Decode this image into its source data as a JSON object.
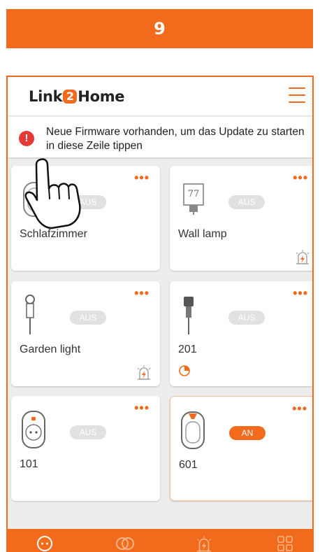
{
  "step": "9",
  "header": {
    "logo_left": "Link",
    "logo_mid": "2",
    "logo_right": "Home"
  },
  "notice": {
    "text": "Neue Firmware vorhanden, um das Update zu starten in diese Zeile tippen"
  },
  "devices": [
    {
      "name": "Schlafzimmer",
      "state": "AUS"
    },
    {
      "name": "Wall lamp",
      "state": "AUS",
      "lamp_label": "77"
    },
    {
      "name": "Garden light",
      "state": "AUS"
    },
    {
      "name": "201",
      "state": "AUS"
    },
    {
      "name": "101",
      "state": "AUS"
    },
    {
      "name": "601",
      "state": "AN"
    }
  ],
  "colors": {
    "accent": "#f26a1b",
    "alert": "#e53935",
    "pill_off": "#e1e1e1"
  },
  "icons": [
    "menu-icon",
    "alert-icon",
    "more-icon",
    "lightning-icon",
    "timer-icon",
    "devices-tab-icon",
    "scenes-tab-icon",
    "automation-tab-icon",
    "more-tab-icon",
    "tap-hand-icon"
  ]
}
